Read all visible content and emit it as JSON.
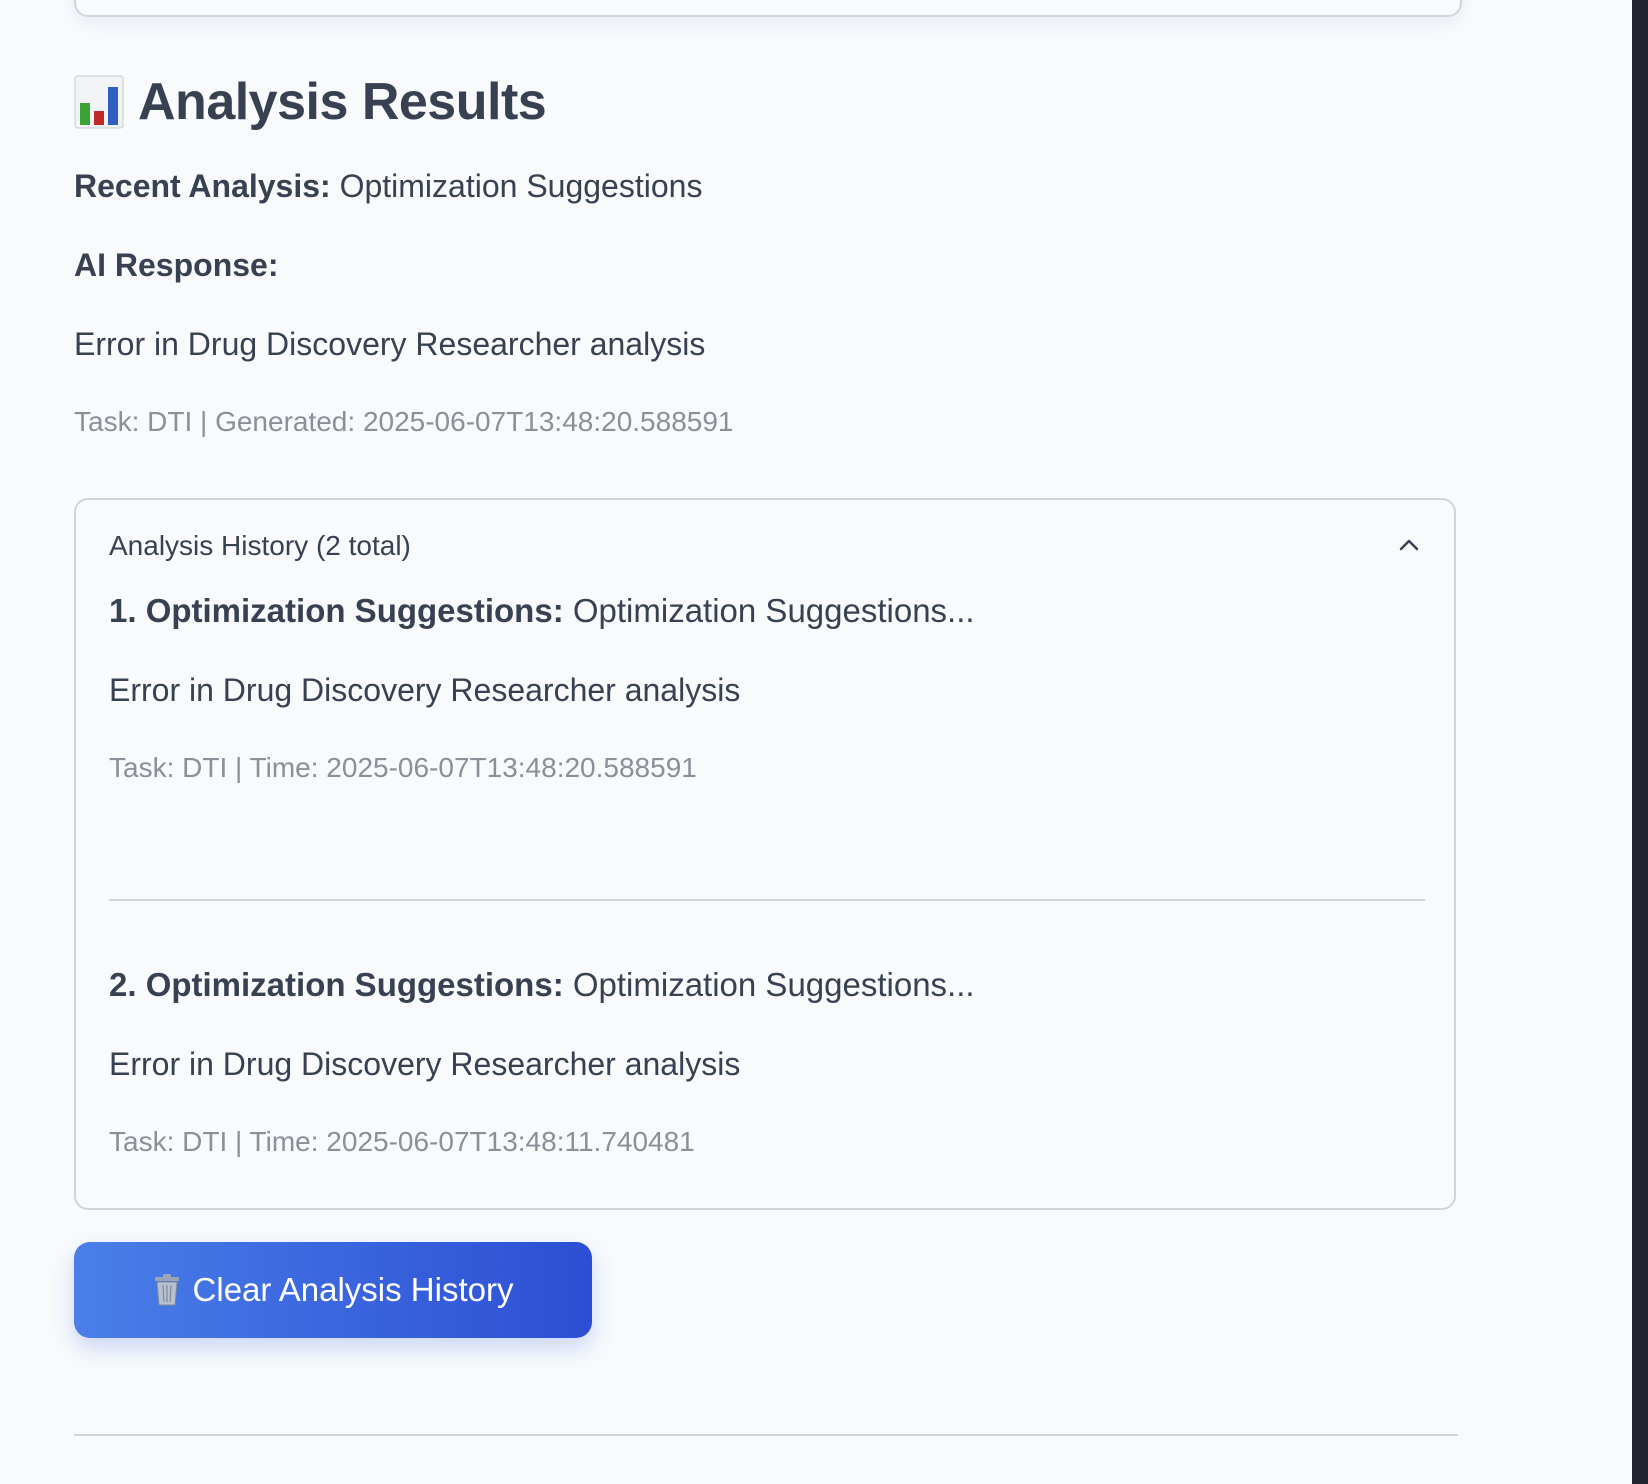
{
  "section": {
    "title": "Analysis Results",
    "title_icon": "bar-chart-icon"
  },
  "recent": {
    "label": "Recent Analysis:",
    "value": "Optimization Suggestions",
    "ai_label": "AI Response:",
    "response": "Error in Drug Discovery Researcher analysis",
    "meta": "Task: DTI | Generated: 2025-06-07T13:48:20.588591"
  },
  "history": {
    "header": "Analysis History (2 total)",
    "expanded": true,
    "toggle_icon": "chevron-up-icon",
    "items": [
      {
        "label": "1. Optimization Suggestions:",
        "summary": "Optimization Suggestions...",
        "response": "Error in Drug Discovery Researcher analysis",
        "meta": "Task: DTI | Time: 2025-06-07T13:48:20.588591"
      },
      {
        "label": "2. Optimization Suggestions:",
        "summary": "Optimization Suggestions...",
        "response": "Error in Drug Discovery Researcher analysis",
        "meta": "Task: DTI | Time: 2025-06-07T13:48:11.740481"
      }
    ]
  },
  "actions": {
    "clear_label": "Clear Analysis History",
    "clear_icon": "trash-icon",
    "clear_color_start": "#4a7fe8",
    "clear_color_end": "#2c4ed4"
  }
}
